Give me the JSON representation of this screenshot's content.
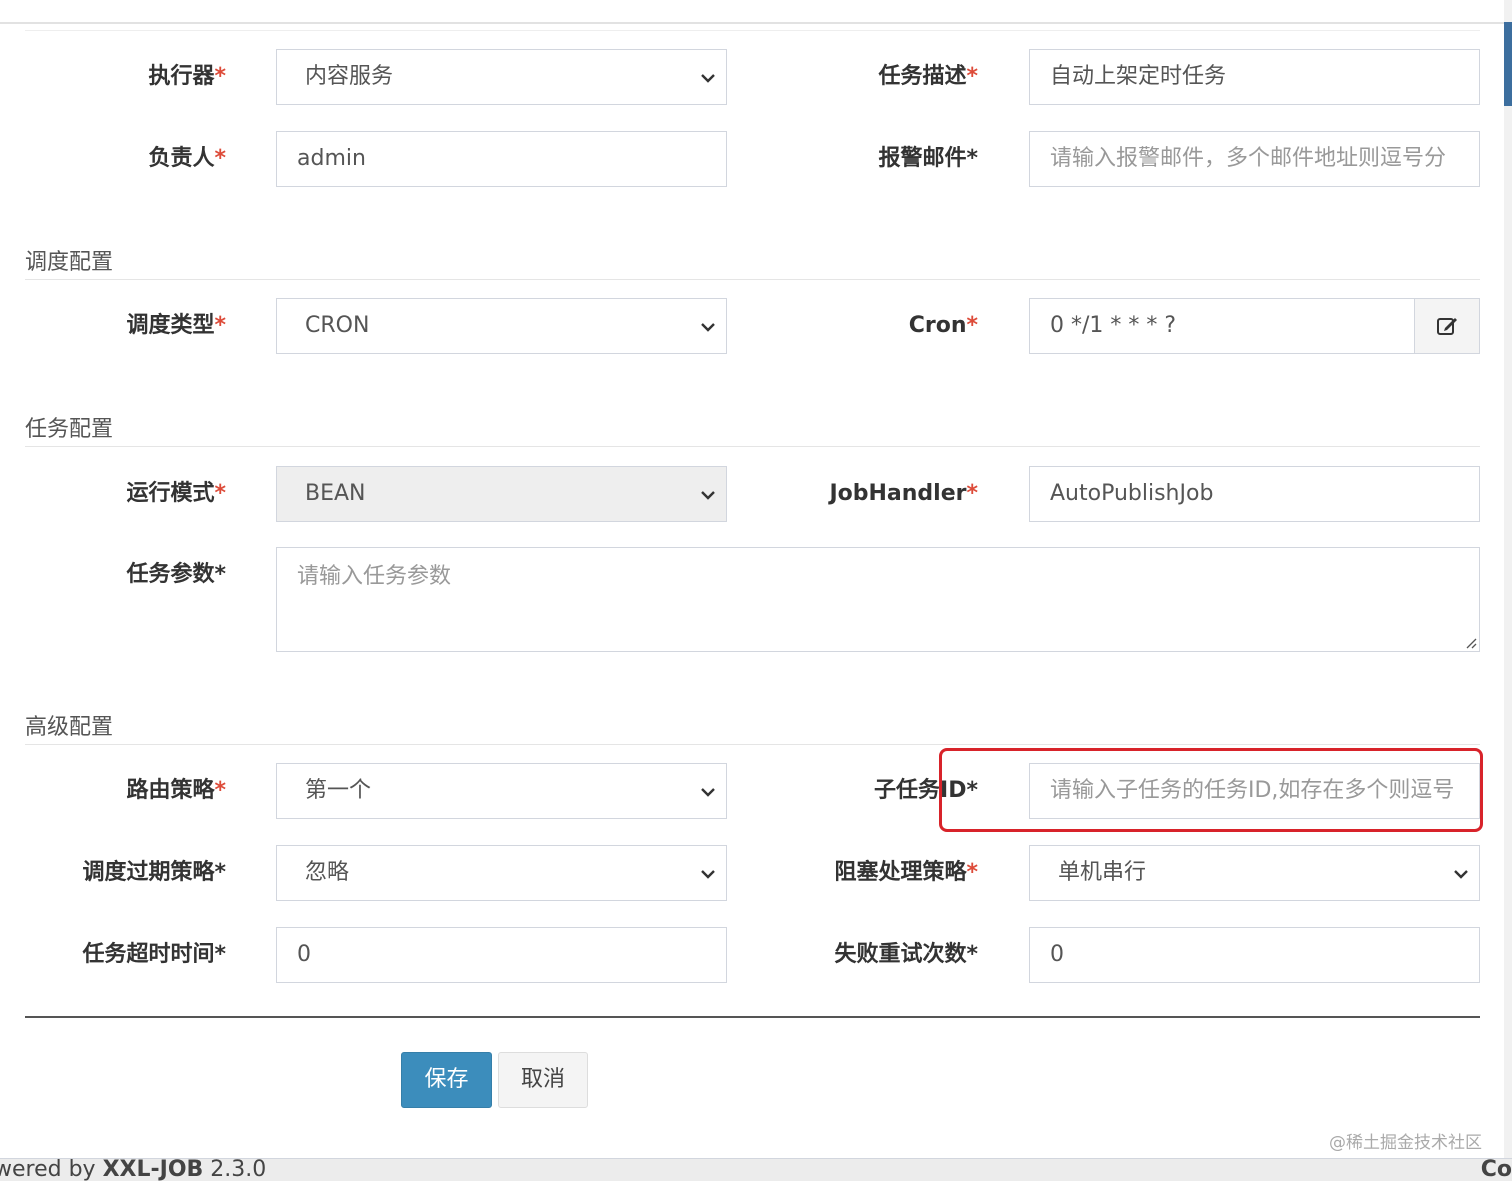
{
  "basic": {
    "executor": {
      "label": "执行器",
      "req": "*",
      "value": "内容服务"
    },
    "job_desc": {
      "label": "任务描述",
      "req": "*",
      "value": "自动上架定时任务"
    },
    "author": {
      "label": "负责人",
      "req": "*",
      "value": "admin"
    },
    "alarm_email": {
      "label": "报警邮件",
      "req": "*",
      "placeholder": "请输入报警邮件，多个邮件地址则逗号分"
    }
  },
  "schedule": {
    "title": "调度配置",
    "type": {
      "label": "调度类型",
      "req": "*",
      "value": "CRON"
    },
    "cron": {
      "label": "Cron",
      "req": "*",
      "value": "0 */1 * * * ?"
    }
  },
  "job": {
    "title": "任务配置",
    "glue_type": {
      "label": "运行模式",
      "req": "*",
      "value": "BEAN"
    },
    "handler": {
      "label": "JobHandler",
      "req": "*",
      "value": "AutoPublishJob"
    },
    "params": {
      "label": "任务参数",
      "req": "*",
      "placeholder": "请输入任务参数"
    }
  },
  "advanced": {
    "title": "高级配置",
    "route": {
      "label": "路由策略",
      "req": "*",
      "value": "第一个"
    },
    "child": {
      "label": "子任务ID",
      "req": "*",
      "placeholder": "请输入子任务的任务ID,如存在多个则逗号"
    },
    "misfire": {
      "label": "调度过期策略",
      "req": "*",
      "value": "忽略"
    },
    "block": {
      "label": "阻塞处理策略",
      "req": "*",
      "value": "单机串行"
    },
    "timeout": {
      "label": "任务超时时间",
      "req": "*",
      "value": "0"
    },
    "retry": {
      "label": "失败重试次数",
      "req": "*",
      "value": "0"
    }
  },
  "actions": {
    "save": "保存",
    "cancel": "取消"
  },
  "watermark": "@稀土掘金技术社区",
  "footer": {
    "prefix": "wered by ",
    "brand": "XXL-JOB",
    "version": " 2.3.0",
    "right": "Co"
  },
  "icons": {
    "cron_button": "edit-icon",
    "select": "chevron-down-icon"
  },
  "colors": {
    "required": "#dd4b39",
    "primary": "#3c8dbc",
    "highlight": "#d8232a"
  }
}
